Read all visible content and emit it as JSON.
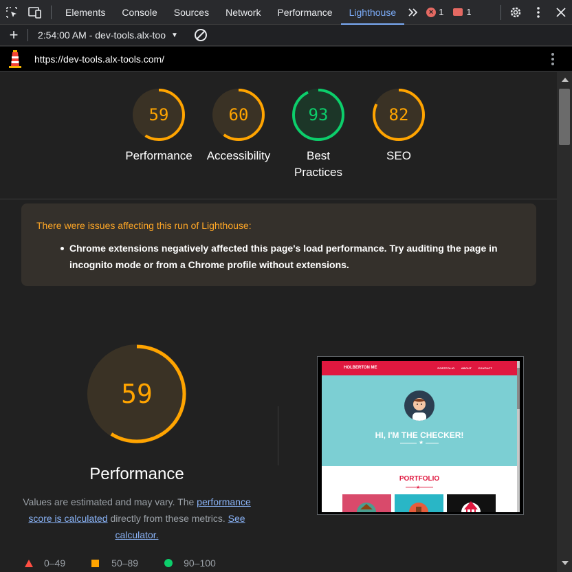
{
  "devtools": {
    "tabs": [
      {
        "label": "Elements"
      },
      {
        "label": "Console"
      },
      {
        "label": "Sources"
      },
      {
        "label": "Network"
      },
      {
        "label": "Performance"
      },
      {
        "label": "Lighthouse",
        "active": true
      }
    ],
    "error_count": "1",
    "issue_count": "1",
    "icons": [
      "inspect-element-icon",
      "device-toolbar-icon",
      "more-tabs-icon",
      "error-circle-icon",
      "issue-message-icon",
      "settings-gear-icon",
      "kebab-menu-icon",
      "close-icon"
    ]
  },
  "toolbar": {
    "report_selector": "2:54:00 AM - dev-tools.alx-too",
    "icons": [
      "new-report-plus-icon",
      "dropdown-caret-icon",
      "clear-block-icon"
    ]
  },
  "urlbar": {
    "url": "https://dev-tools.alx-tools.com/",
    "icons": [
      "lighthouse-logo-icon",
      "kebab-menu-icon"
    ]
  },
  "scores": [
    {
      "value": 59,
      "label": "Performance",
      "color": "#ffa400"
    },
    {
      "value": 60,
      "label": "Accessibility",
      "color": "#ffa400"
    },
    {
      "value": 93,
      "label": "Best Practices",
      "color": "#0cce6b"
    },
    {
      "value": 82,
      "label": "SEO",
      "color": "#ffa400"
    }
  ],
  "warning": {
    "title": "There were issues affecting this run of Lighthouse:",
    "items": [
      "Chrome extensions negatively affected this page's load performance. Try auditing the page in incognito mode or from a Chrome profile without extensions."
    ]
  },
  "performance": {
    "score": 59,
    "title": "Performance",
    "desc_part1": "Values are estimated and may vary. The ",
    "link1": "performance score is calculated",
    "desc_part2": " directly from these metrics. ",
    "link2": "See calculator."
  },
  "legend": [
    {
      "range": "0–49",
      "color": "#ff4e42",
      "shape": "triangle"
    },
    {
      "range": "50–89",
      "color": "#ffa400",
      "shape": "square"
    },
    {
      "range": "90–100",
      "color": "#0cce6b",
      "shape": "circle"
    }
  ],
  "screenshot": {
    "brand": "HOLBERTON ME",
    "nav_links": [
      "PORTFOLIO",
      "ABOUT",
      "CONTACT"
    ],
    "hero_text": "HI, I'M THE CHECKER!",
    "section_title": "PORTFOLIO",
    "accent_color": "#e0183f",
    "hero_color": "#7ccfd3"
  },
  "colors": {
    "fail": "#ff4e42",
    "average": "#ffa400",
    "pass": "#0cce6b",
    "link": "#8ab4f8",
    "active_tab": "#7cacf8"
  }
}
